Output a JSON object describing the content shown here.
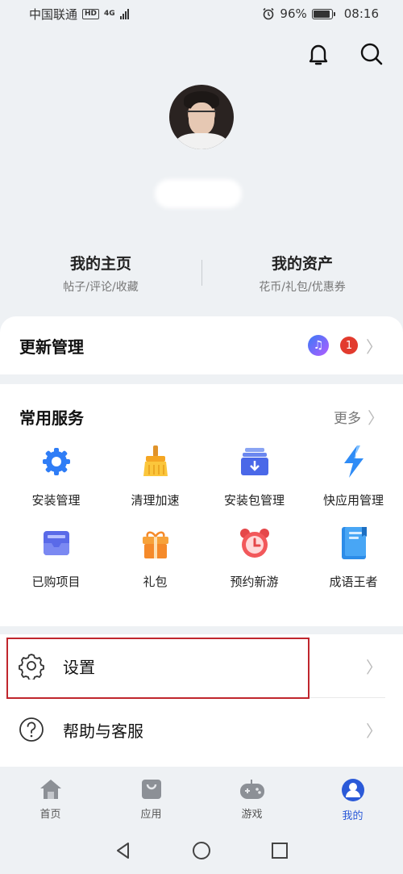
{
  "status": {
    "carrier": "中国联通",
    "hd": "HD",
    "network": "4G",
    "battery": "96%",
    "time": "08:16"
  },
  "header": {
    "bell_icon": "bell-icon",
    "search_icon": "search-icon"
  },
  "profile": {
    "home": {
      "title": "我的主页",
      "sub": "帖子/评论/收藏"
    },
    "assets": {
      "title": "我的资产",
      "sub": "花币/礼包/优惠券"
    }
  },
  "update": {
    "title": "更新管理",
    "badge": "1"
  },
  "services": {
    "title": "常用服务",
    "more": "更多",
    "items": [
      {
        "label": "安装管理",
        "icon": "gear-blue-icon"
      },
      {
        "label": "清理加速",
        "icon": "broom-icon"
      },
      {
        "label": "安装包管理",
        "icon": "package-download-icon"
      },
      {
        "label": "快应用管理",
        "icon": "lightning-icon"
      },
      {
        "label": "已购项目",
        "icon": "purchased-tray-icon"
      },
      {
        "label": "礼包",
        "icon": "gift-icon"
      },
      {
        "label": "预约新游",
        "icon": "alarm-clock-icon"
      },
      {
        "label": "成语王者",
        "icon": "book-icon"
      }
    ]
  },
  "menu": {
    "settings": "设置",
    "help": "帮助与客服"
  },
  "tabs": [
    {
      "label": "首页",
      "icon": "home-icon"
    },
    {
      "label": "应用",
      "icon": "bag-icon"
    },
    {
      "label": "游戏",
      "icon": "gamepad-icon"
    },
    {
      "label": "我的",
      "icon": "user-icon"
    }
  ],
  "colors": {
    "accent": "#2b5ad8",
    "badge": "#e23b2e",
    "highlight": "#c0262d"
  }
}
